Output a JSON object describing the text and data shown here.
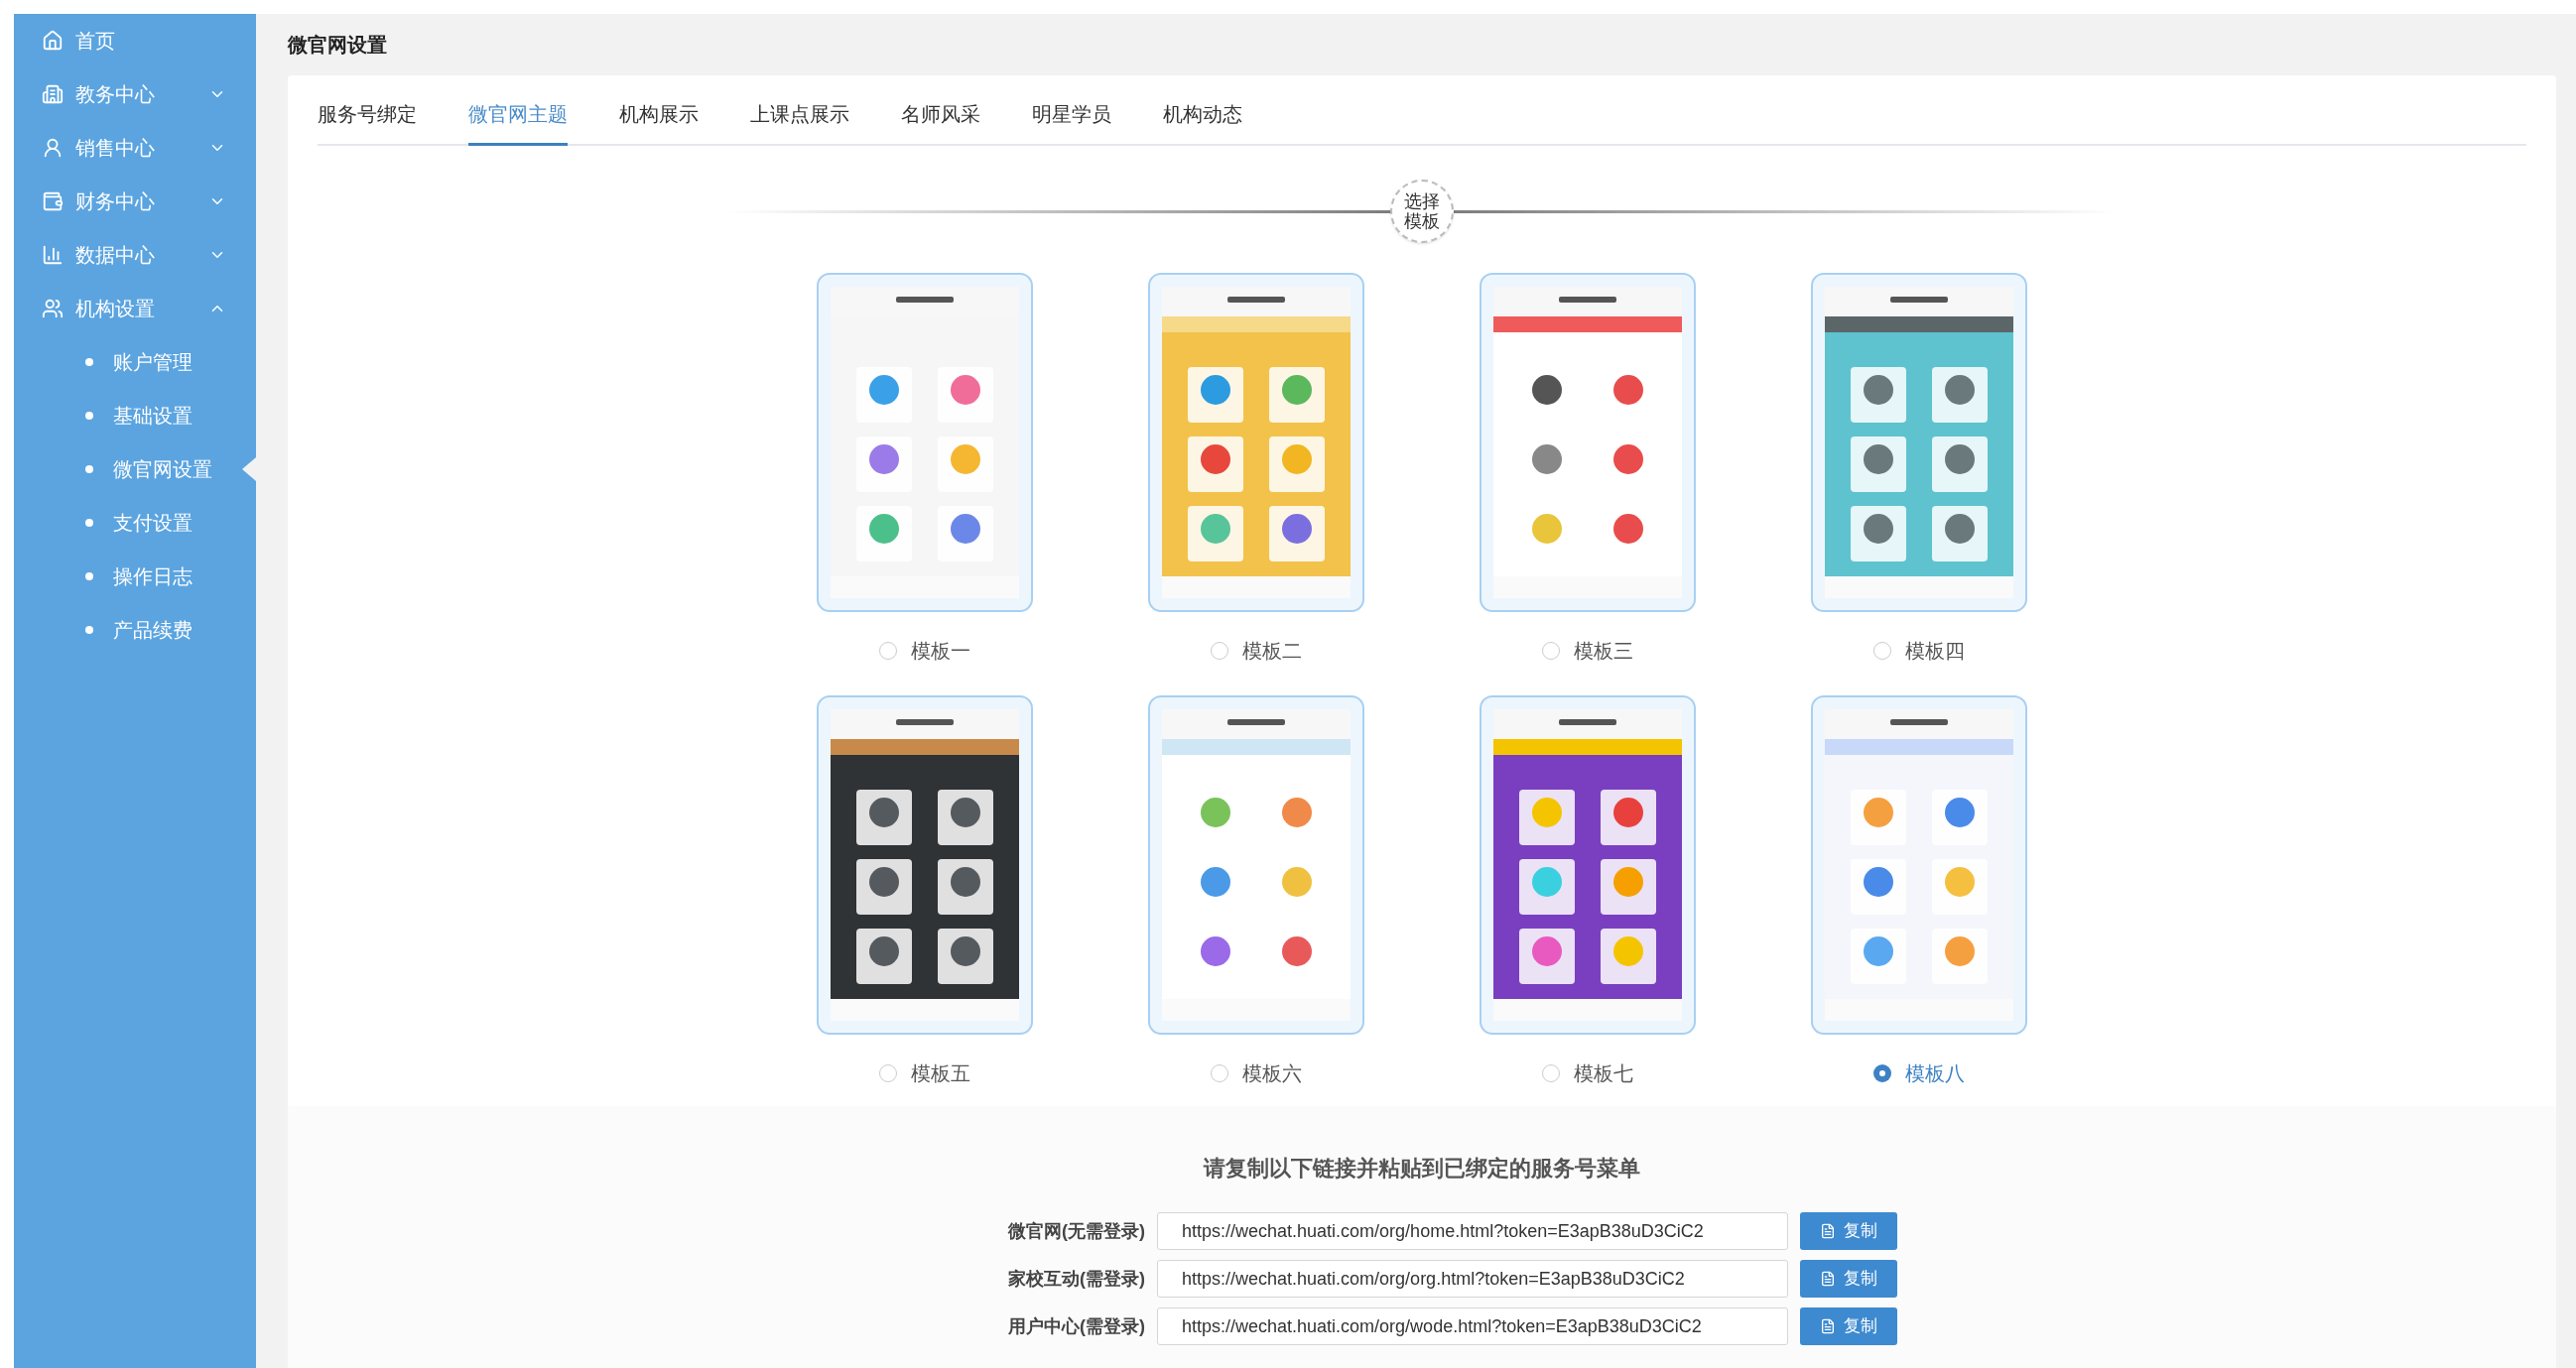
{
  "sidebar": {
    "items": [
      {
        "label": "首页"
      },
      {
        "label": "教务中心",
        "expanded": false
      },
      {
        "label": "销售中心",
        "expanded": false
      },
      {
        "label": "财务中心",
        "expanded": false
      },
      {
        "label": "数据中心",
        "expanded": false
      },
      {
        "label": "机构设置",
        "expanded": true,
        "children": [
          {
            "label": "账户管理",
            "selected": false
          },
          {
            "label": "基础设置",
            "selected": false
          },
          {
            "label": "微官网设置",
            "selected": true
          },
          {
            "label": "支付设置",
            "selected": false
          },
          {
            "label": "操作日志",
            "selected": false
          },
          {
            "label": "产品续费",
            "selected": false
          }
        ]
      }
    ]
  },
  "page_title": "微官网设置",
  "tabs": [
    {
      "label": "服务号绑定",
      "selected": false
    },
    {
      "label": "微官网主题",
      "selected": true
    },
    {
      "label": "机构展示",
      "selected": false
    },
    {
      "label": "上课点展示",
      "selected": false
    },
    {
      "label": "名师风采",
      "selected": false
    },
    {
      "label": "明星学员",
      "selected": false
    },
    {
      "label": "机构动态",
      "selected": false
    }
  ],
  "section_badge": "选择模板",
  "templates": [
    {
      "label": "模板一",
      "selected": false
    },
    {
      "label": "模板二",
      "selected": false
    },
    {
      "label": "模板三",
      "selected": false
    },
    {
      "label": "模板四",
      "selected": false
    },
    {
      "label": "模板五",
      "selected": false
    },
    {
      "label": "模板六",
      "selected": false
    },
    {
      "label": "模板七",
      "selected": false
    },
    {
      "label": "模板八",
      "selected": true
    }
  ],
  "links_title": "请复制以下链接并粘贴到已绑定的服务号菜单",
  "links": [
    {
      "label": "微官网(无需登录)",
      "value": "https://wechat.huati.com/org/home.html?token=E3apB38uD3CiC2",
      "button": "复制"
    },
    {
      "label": "家校互动(需登录)",
      "value": "https://wechat.huati.com/org/org.html?token=E3apB38uD3CiC2",
      "button": "复制"
    },
    {
      "label": "用户中心(需登录)",
      "value": "https://wechat.huati.com/org/wode.html?token=E3apB38uD3CiC2",
      "button": "复制"
    }
  ]
}
